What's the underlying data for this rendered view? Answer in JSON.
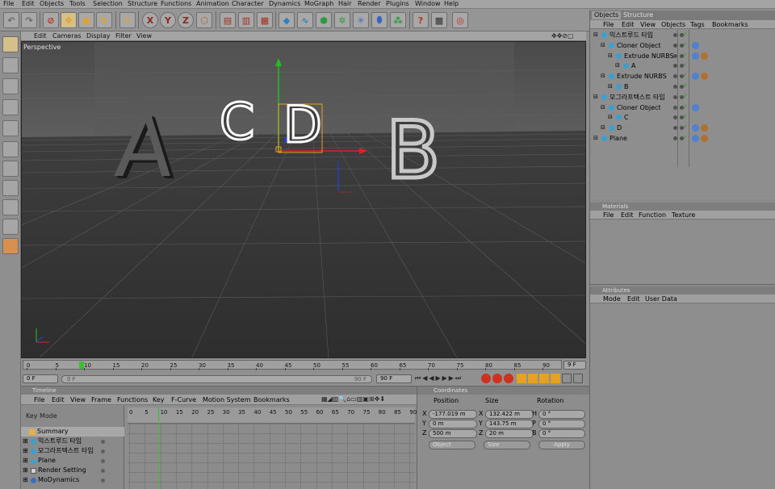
{
  "menubar": [
    "File",
    "Edit",
    "Objects",
    "Tools",
    "Selection",
    "Structure",
    "Functions",
    "Animation",
    "Character",
    "Dynamics",
    "MoGraph",
    "Hair",
    "Render",
    "Plugins",
    "Window",
    "Help"
  ],
  "toolbar": {
    "x_label": "X",
    "y_label": "Y",
    "z_label": "Z"
  },
  "viewport": {
    "menu": [
      "Edit",
      "Cameras",
      "Display",
      "Filter",
      "View"
    ],
    "label": "Perspective",
    "letters": {
      "a": "A",
      "b": "B",
      "c": "C",
      "d": "D"
    }
  },
  "timeline_ruler": {
    "ticks": [
      "0",
      "5",
      "10",
      "15",
      "20",
      "25",
      "30",
      "35",
      "40",
      "45",
      "50",
      "55",
      "60",
      "65",
      "70",
      "75",
      "80",
      "85",
      "90"
    ],
    "end_field": "9 F"
  },
  "transport": {
    "start": "0 F",
    "current": "0 F",
    "range_end": "90 F",
    "end": "90 F"
  },
  "timeline_panel": {
    "title": "Timeline",
    "menu": [
      "File",
      "Edit",
      "View",
      "Frame",
      "Functions",
      "Key",
      "F-Curve",
      "Motion System",
      "Bookmarks"
    ],
    "mode": "Key Mode",
    "ticks": [
      "0",
      "5",
      "10",
      "15",
      "20",
      "25",
      "30",
      "35",
      "40",
      "45",
      "50",
      "55",
      "60",
      "65",
      "70",
      "75",
      "80",
      "85",
      "90"
    ],
    "items": [
      "Summary",
      "익스트루드 타입",
      "모그라프텍스트 타입",
      "Plane",
      "Render Setting",
      "MoDynamics"
    ]
  },
  "coordinates": {
    "title": "Coordinates",
    "headers": [
      "Position",
      "Size",
      "Rotation"
    ],
    "rows": [
      {
        "axis": "X",
        "pos": "-177.019 m",
        "saxis": "X",
        "size": "132.422 m",
        "raxis": "H",
        "rot": "0 °"
      },
      {
        "axis": "Y",
        "pos": "0 m",
        "saxis": "Y",
        "size": "143.75 m",
        "raxis": "P",
        "rot": "0 °"
      },
      {
        "axis": "Z",
        "pos": "500 m",
        "saxis": "Z",
        "size": "20 m",
        "raxis": "B",
        "rot": "0 °"
      }
    ],
    "mode": "Object",
    "size_mode": "Size",
    "apply": "Apply"
  },
  "objects_panel": {
    "tabs": [
      "Objects",
      "Structure"
    ],
    "menu": [
      "File",
      "Edit",
      "View",
      "Objects",
      "Tags",
      "Bookmarks"
    ],
    "rows": [
      {
        "name": "익스트루드 타입",
        "indent": 0
      },
      {
        "name": "Cloner Object",
        "indent": 1
      },
      {
        "name": "Extrude NURBS",
        "indent": 2
      },
      {
        "name": "A",
        "indent": 3
      },
      {
        "name": "Extrude NURBS",
        "indent": 1
      },
      {
        "name": "B",
        "indent": 2
      },
      {
        "name": "모그라프텍스트 타입",
        "indent": 0
      },
      {
        "name": "Cloner Object",
        "indent": 1
      },
      {
        "name": "C",
        "indent": 2
      },
      {
        "name": "D",
        "indent": 1
      },
      {
        "name": "Plane",
        "indent": 0
      }
    ]
  },
  "materials_panel": {
    "title": "Materials",
    "menu": [
      "File",
      "Edit",
      "Function",
      "Texture"
    ]
  },
  "attributes_panel": {
    "title": "Attributes",
    "menu": [
      "Mode",
      "Edit",
      "User Data"
    ]
  },
  "colors": {
    "ui_gray": "#8e8e8e",
    "viewport_bg": "#3b3b3b",
    "accent_orange": "#e8a020",
    "axis_x": "#e02020",
    "axis_y": "#20c020",
    "axis_z": "#2040e0"
  }
}
